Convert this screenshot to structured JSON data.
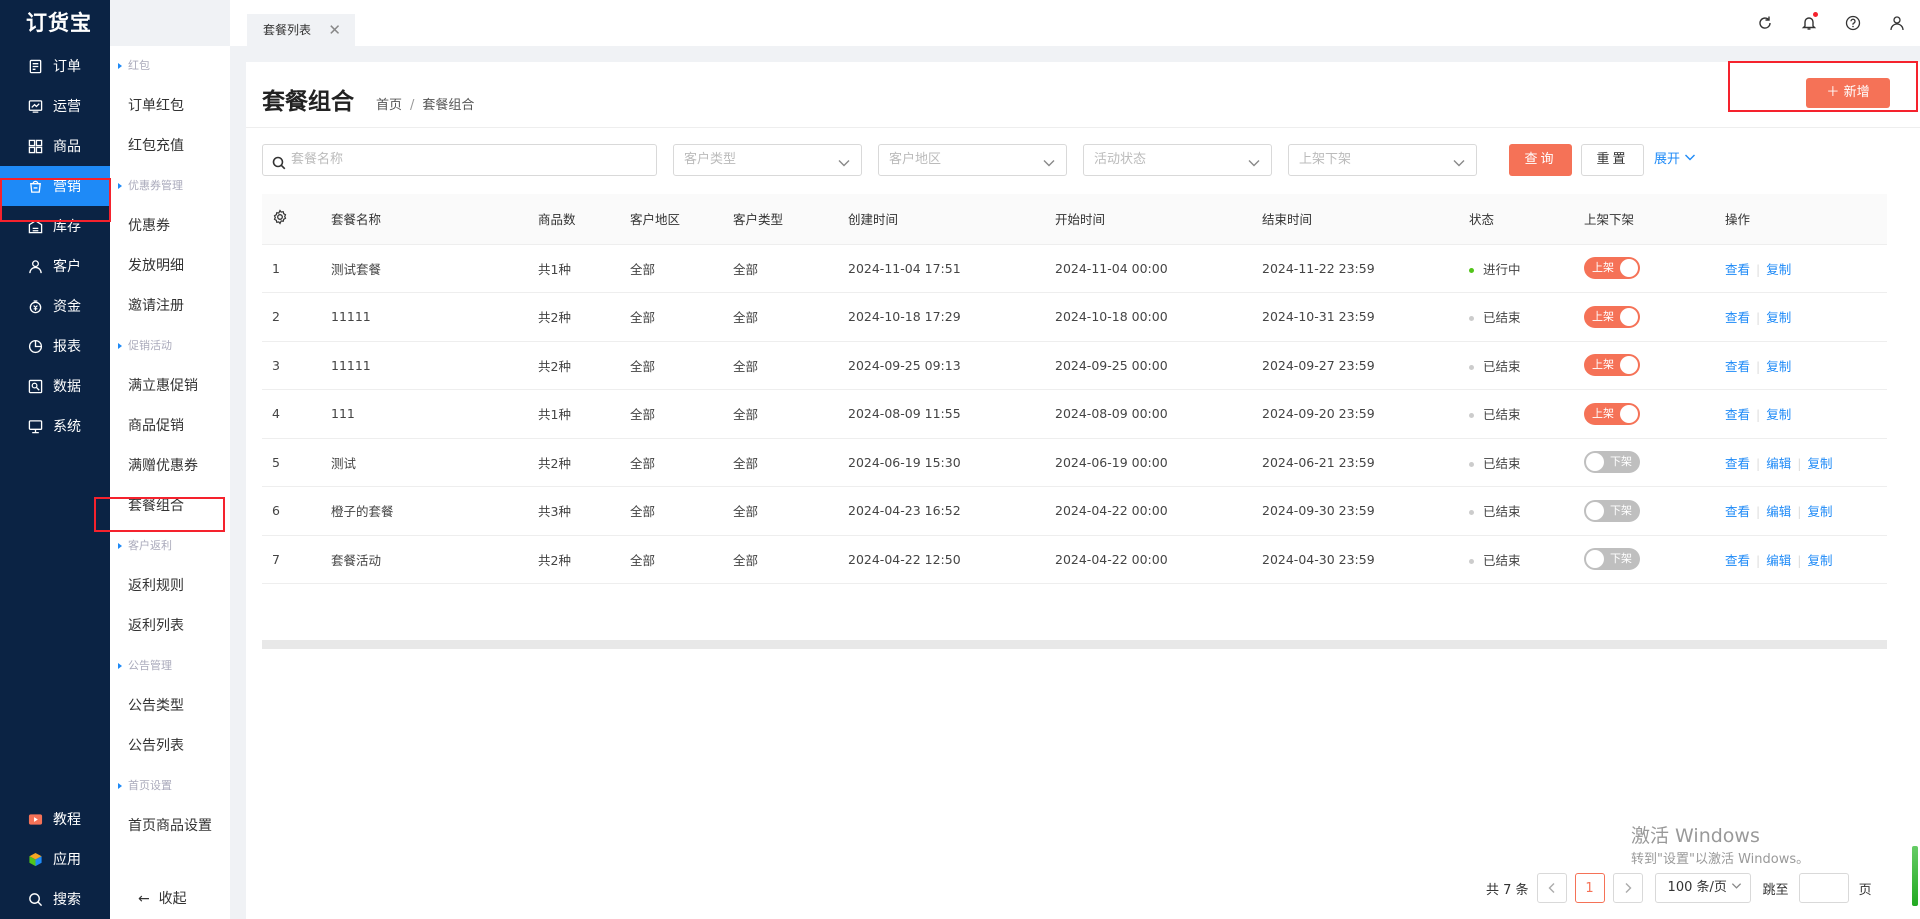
{
  "app": {
    "logo": "订货宝"
  },
  "main_nav": [
    {
      "label": "订单",
      "icon": "order-icon"
    },
    {
      "label": "运营",
      "icon": "operation-icon"
    },
    {
      "label": "商品",
      "icon": "goods-icon"
    },
    {
      "label": "营销",
      "icon": "marketing-icon",
      "active": true
    },
    {
      "label": "库存",
      "icon": "stock-icon"
    },
    {
      "label": "客户",
      "icon": "customer-icon"
    },
    {
      "label": "资金",
      "icon": "money-icon"
    },
    {
      "label": "报表",
      "icon": "report-icon"
    },
    {
      "label": "数据",
      "icon": "data-icon"
    },
    {
      "label": "系统",
      "icon": "system-icon"
    }
  ],
  "main_nav_bottom": [
    {
      "label": "教程",
      "icon": "tutorial-icon"
    },
    {
      "label": "应用",
      "icon": "apps-icon"
    },
    {
      "label": "搜索",
      "icon": "search-icon"
    }
  ],
  "sub_nav": {
    "groups": [
      {
        "title": "红包",
        "items": [
          "订单红包",
          "红包充值"
        ]
      },
      {
        "title": "优惠券管理",
        "items": [
          "优惠券",
          "发放明细",
          "邀请注册"
        ]
      },
      {
        "title": "促销活动",
        "items": [
          "满立惠促销",
          "商品促销",
          "满赠优惠券",
          "套餐组合"
        ]
      },
      {
        "title": "客户返利",
        "items": [
          "返利规则",
          "返利列表"
        ]
      },
      {
        "title": "公告管理",
        "items": [
          "公告类型",
          "公告列表"
        ]
      },
      {
        "title": "首页设置",
        "items": [
          "首页商品设置"
        ]
      }
    ],
    "collapse_label": "收起"
  },
  "tabs": [
    {
      "label": "套餐列表",
      "close": "✕"
    }
  ],
  "page": {
    "title": "套餐组合",
    "breadcrumb": [
      "首页",
      "套餐组合"
    ],
    "breadcrumb_sep": "/",
    "add_label": "新增",
    "add_icon": "＋"
  },
  "filters": {
    "search_placeholder": "套餐名称",
    "selects": [
      "客户类型",
      "客户地区",
      "活动状态",
      "上架下架"
    ],
    "query_label": "查询",
    "reset_label": "重置",
    "expand_label": "展开"
  },
  "table": {
    "columns": [
      "套餐名称",
      "商品数",
      "客户地区",
      "客户类型",
      "创建时间",
      "开始时间",
      "结束时间",
      "状态",
      "上架下架",
      "操作"
    ],
    "rows": [
      {
        "no": "1",
        "name": "测试套餐",
        "count": "共1种",
        "region": "全部",
        "ctype": "全部",
        "created": "2024-11-04 17:51",
        "start": "2024-11-04 00:00",
        "end": "2024-11-22 23:59",
        "status": "进行中",
        "status_color": "#52c41a",
        "switch_on": true,
        "switch_label": "上架",
        "ops": [
          "查看",
          "复制"
        ]
      },
      {
        "no": "2",
        "name": "11111",
        "count": "共2种",
        "region": "全部",
        "ctype": "全部",
        "created": "2024-10-18 17:29",
        "start": "2024-10-18 00:00",
        "end": "2024-10-31 23:59",
        "status": "已结束",
        "status_color": "#ccc",
        "switch_on": true,
        "switch_label": "上架",
        "ops": [
          "查看",
          "复制"
        ]
      },
      {
        "no": "3",
        "name": "11111",
        "count": "共2种",
        "region": "全部",
        "ctype": "全部",
        "created": "2024-09-25 09:13",
        "start": "2024-09-25 00:00",
        "end": "2024-09-27 23:59",
        "status": "已结束",
        "status_color": "#ccc",
        "switch_on": true,
        "switch_label": "上架",
        "ops": [
          "查看",
          "复制"
        ]
      },
      {
        "no": "4",
        "name": "111",
        "count": "共1种",
        "region": "全部",
        "ctype": "全部",
        "created": "2024-08-09 11:55",
        "start": "2024-08-09 00:00",
        "end": "2024-09-20 23:59",
        "status": "已结束",
        "status_color": "#ccc",
        "switch_on": true,
        "switch_label": "上架",
        "ops": [
          "查看",
          "复制"
        ]
      },
      {
        "no": "5",
        "name": "测试",
        "count": "共2种",
        "region": "全部",
        "ctype": "全部",
        "created": "2024-06-19 15:30",
        "start": "2024-06-19 00:00",
        "end": "2024-06-21 23:59",
        "status": "已结束",
        "status_color": "#ccc",
        "switch_on": false,
        "switch_label": "下架",
        "ops": [
          "查看",
          "编辑",
          "复制"
        ]
      },
      {
        "no": "6",
        "name": "橙子的套餐",
        "count": "共3种",
        "region": "全部",
        "ctype": "全部",
        "created": "2024-04-23 16:52",
        "start": "2024-04-22 00:00",
        "end": "2024-09-30 23:59",
        "status": "已结束",
        "status_color": "#ccc",
        "switch_on": false,
        "switch_label": "下架",
        "ops": [
          "查看",
          "编辑",
          "复制"
        ]
      },
      {
        "no": "7",
        "name": "套餐活动",
        "count": "共2种",
        "region": "全部",
        "ctype": "全部",
        "created": "2024-04-22 12:50",
        "start": "2024-04-22 00:00",
        "end": "2024-04-30 23:59",
        "status": "已结束",
        "status_color": "#ccc",
        "switch_on": false,
        "switch_label": "下架",
        "ops": [
          "查看",
          "编辑",
          "复制"
        ]
      }
    ]
  },
  "pagination": {
    "total_label": "共 7 条",
    "current_page": "1",
    "page_size": "100 条/页",
    "jump_label": "跳至",
    "page_unit": "页"
  },
  "watermark": {
    "line1": "激活 Windows",
    "line2": "转到\"设置\"以激活 Windows。"
  },
  "colors": {
    "accent": "#f57257",
    "nav_bg": "#0b2344",
    "nav_active": "#1e8af7",
    "link": "#1e8af7"
  }
}
